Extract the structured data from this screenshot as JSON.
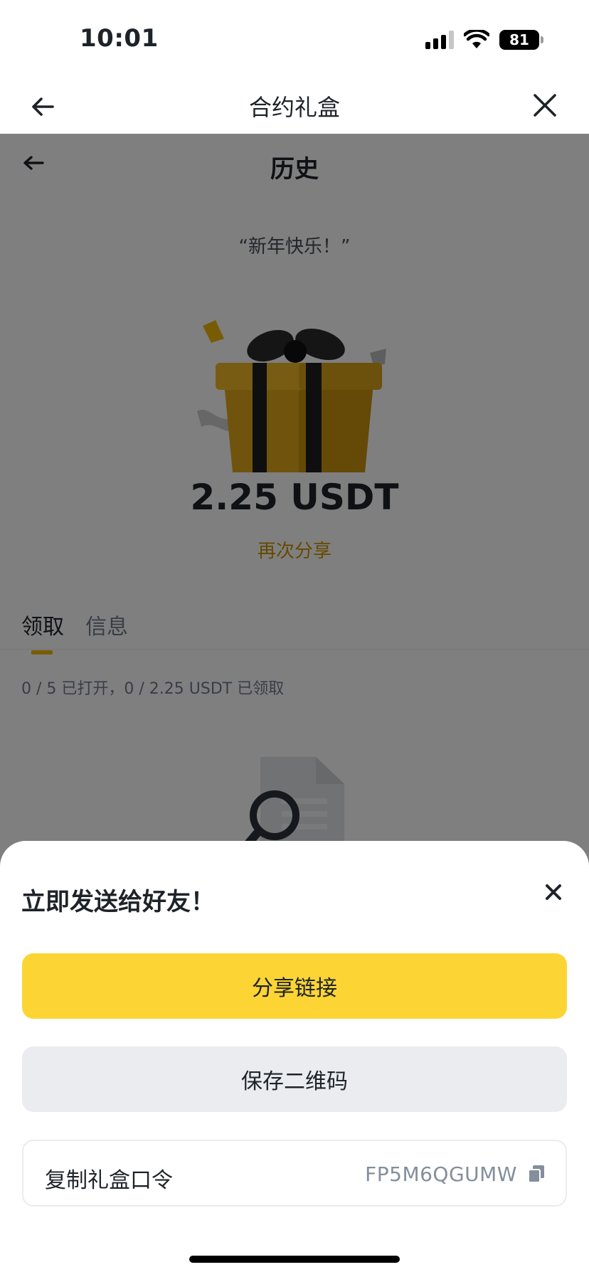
{
  "status_bar": {
    "time": "10:01",
    "battery": "81"
  },
  "header": {
    "title": "合约礼盒"
  },
  "page": {
    "title": "历史",
    "greeting": "“新年快乐！”",
    "amount": "2.25 USDT",
    "share_again": "再次分享",
    "tabs": [
      {
        "label": "领取",
        "active": true
      },
      {
        "label": "信息",
        "active": false
      }
    ],
    "claim_summary": "0 / 5 已打开，0 / 2.25 USDT 已领取"
  },
  "sheet": {
    "title": "立即发送给好友！",
    "share_link": "分享链接",
    "save_qr": "保存二维码",
    "copy_code_label": "复制礼盒口令",
    "code": "FP5M6QGUMW"
  },
  "colors": {
    "primary_yellow": "#fcd535",
    "accent_gold": "#c99400",
    "text": "#1e2329"
  }
}
